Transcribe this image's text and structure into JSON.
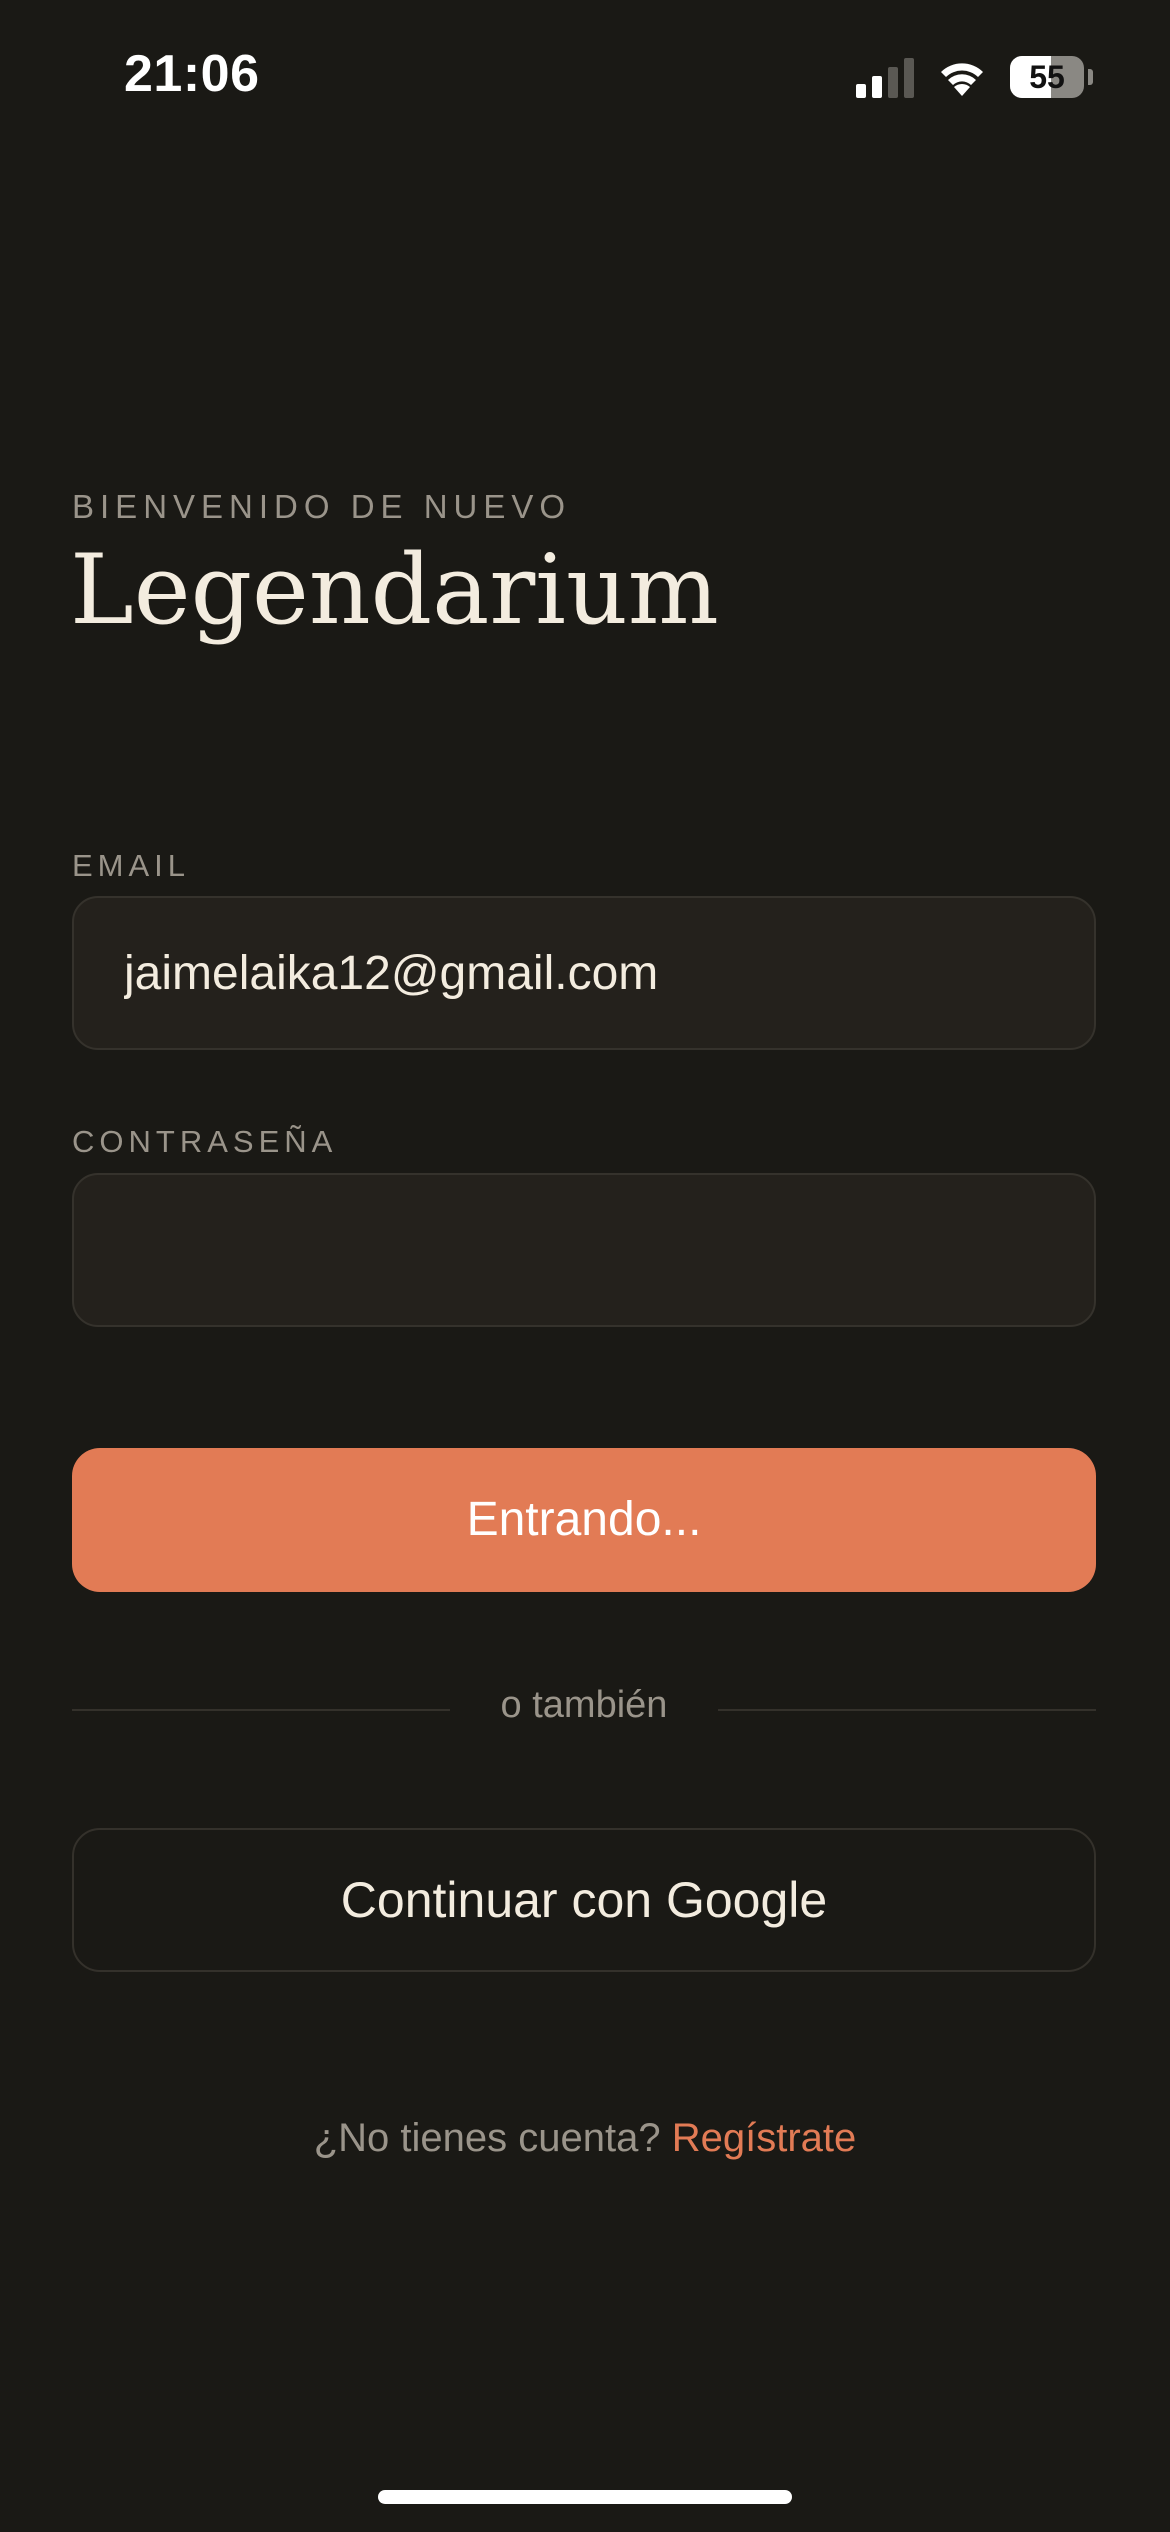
{
  "status_bar": {
    "time": "21:06",
    "battery_level": "55",
    "battery_fraction": 0.55,
    "icons": [
      "signal-icon",
      "wifi-icon",
      "battery-icon"
    ]
  },
  "header": {
    "eyebrow": "BIENVENIDO DE NUEVO",
    "title": "Legendarium"
  },
  "form": {
    "email_label": "EMAIL",
    "email_value": "jaimelaika12@gmail.com",
    "password_label": "CONTRASEÑA",
    "password_value": "",
    "submit_label": "Entrando..."
  },
  "divider": {
    "text": "o también"
  },
  "google": {
    "label": "Continuar con Google"
  },
  "signup": {
    "prompt": "¿No tienes cuenta?",
    "link": "Regístrate"
  },
  "colors": {
    "background": "#1a1915",
    "accent": "#e27b55",
    "field_bg": "#24211c",
    "muted_text": "#9a948a",
    "primary_text": "#f3ecdf"
  }
}
